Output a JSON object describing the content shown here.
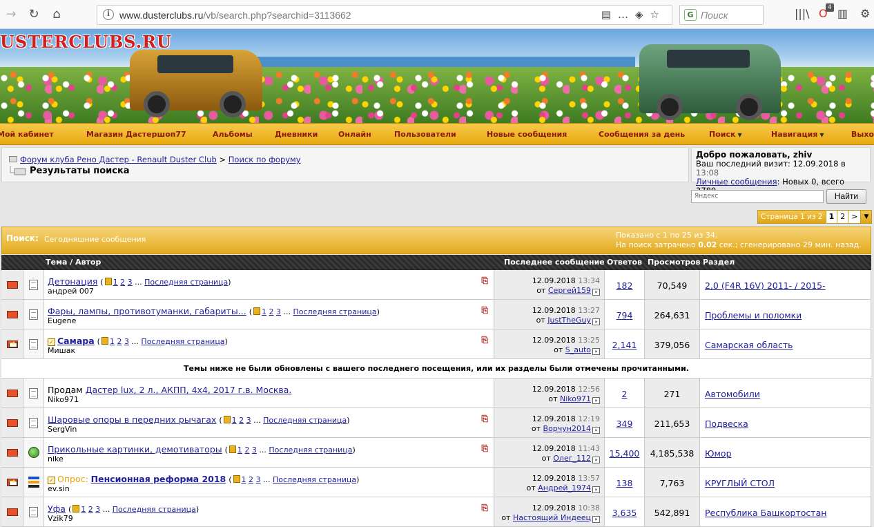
{
  "browser": {
    "url_host": "www.dusterclubs.ru",
    "url_path": "/vb/search.php?searchid=3113662",
    "search_placeholder": "Поиск",
    "notification_count": "4"
  },
  "banner": {
    "logo_text": "USTERCLUBS.RU"
  },
  "menu": {
    "items": [
      "Мой кабинет",
      "Магазин Дастершоп77",
      "Альбомы",
      "Дневники",
      "Онлайн",
      "Пользователи",
      "Новые сообщения",
      "Сообщения за день",
      "Поиск",
      "Навигация",
      "Выход"
    ]
  },
  "breadcrumb": {
    "forum": "Форум клуба Рено Дастер - Renault Duster Club",
    "sep": ">",
    "search": "Поиск по форуму",
    "title": "Результаты поиска"
  },
  "welcome": {
    "greeting": "Добро пожаловать, zhiv",
    "last_visit_label": "Ваш последний визит: 12.09.2018 в",
    "last_visit_time": "13:08",
    "pm_link": "Личные сообщения",
    "pm_text": ": Новых 0, всего 3789."
  },
  "yandex": {
    "placeholder": "Яндекс",
    "button": "Найти"
  },
  "pager": {
    "label": "Страница 1 из 2",
    "current": "1",
    "next_page": "2",
    "next_arrow": ">",
    "menu": "▼"
  },
  "search_head": {
    "label": "Поиск:",
    "value": "Сегодняшние сообщения",
    "shown": "Показано с 1 по 25 из 34.",
    "time_prefix": "На поиск затрачено",
    "time_value": "0.02",
    "time_suffix": "сек.; сгенерировано 29 мин. назад."
  },
  "table": {
    "headers": {
      "topic": "Тема / Автор",
      "last": "Последнее сообщение",
      "replies": "Ответов",
      "views": "Просмотров",
      "forum": "Раздел"
    },
    "last_page_label": "Последняя страница",
    "separator": "Темы ниже не были обновлены с вашего последнего посещения, или их разделы были отмечены прочитанными.",
    "by_prefix": "от",
    "rows": [
      {
        "title": "Детонация",
        "author": "андрей 007",
        "date": "12.09.2018",
        "time": "13:34",
        "by": "Сергей159",
        "replies": "182",
        "views": "70,549",
        "forum": "2,0 (F4R 16V) 2011- / 2015-",
        "pages": [
          "1",
          "2",
          "3"
        ]
      },
      {
        "title": "Фары, лампы, противотуманки, габариты...",
        "author": "Eugene",
        "date": "12.09.2018",
        "time": "13:27",
        "by": "JustTheGuy",
        "replies": "794",
        "views": "264,631",
        "forum": "Проблемы и поломки",
        "pages": [
          "1",
          "2",
          "3"
        ]
      },
      {
        "title": "Самара",
        "author": "Мишак",
        "date": "12.09.2018",
        "time": "13:25",
        "by": "S_auto",
        "replies": "2,141",
        "views": "379,056",
        "forum": "Самарская область",
        "pages": [
          "1",
          "2",
          "3"
        ]
      },
      {
        "prefix_text": "Продам",
        "title": "Дастер lux, 2 л., АКПП, 4х4, 2017 г.в. Москва.",
        "author": "Niko971",
        "date": "12.09.2018",
        "time": "12:56",
        "by": "Niko971",
        "replies": "2",
        "views": "271",
        "forum": "Автомобили"
      },
      {
        "title": "Шаровые опоры в передних рычагах",
        "author": "SergVin",
        "date": "12.09.2018",
        "time": "12:19",
        "by": "Ворчун2014",
        "replies": "349",
        "views": "211,653",
        "forum": "Подвеска",
        "pages": [
          "1",
          "2",
          "3"
        ]
      },
      {
        "title": "Прикольные картинки, демотиваторы",
        "author": "nike",
        "date": "12.09.2018",
        "time": "11:43",
        "by": "Олег_112",
        "replies": "15,400",
        "views": "4,185,538",
        "forum": "Юмор",
        "pages": [
          "1",
          "2",
          "3"
        ]
      },
      {
        "prefix_text": "Опрос:",
        "title": "Пенсионная реформа 2018",
        "author": "ev.sin",
        "date": "12.09.2018",
        "time": "13:57",
        "by": "Андрей_1974",
        "replies": "138",
        "views": "7,763",
        "forum": "КРУГЛЫЙ СТОЛ",
        "pages": [
          "1",
          "2",
          "3"
        ]
      },
      {
        "title": "Уфа",
        "author": "Vzik79",
        "date": "12.09.2018",
        "time": "10:38",
        "by": "Настоящий Индеец",
        "replies": "3,635",
        "views": "542,891",
        "forum": "Республика Башкортостан",
        "pages": [
          "1",
          "2",
          "3"
        ]
      }
    ]
  }
}
